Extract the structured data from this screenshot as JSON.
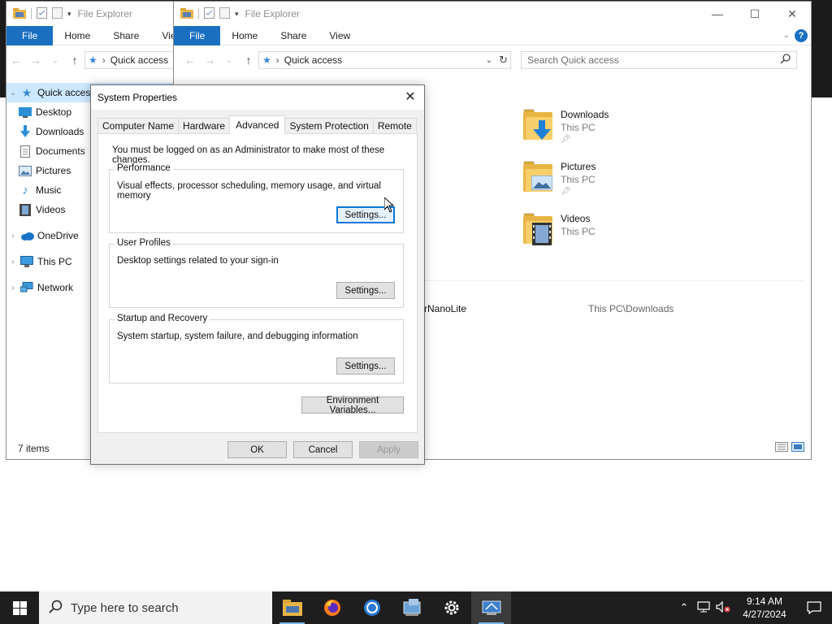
{
  "back_window": {
    "title": "File Explorer",
    "ribbon_tabs": [
      "File",
      "Home",
      "Share",
      "View"
    ],
    "address": "Quick access",
    "nav_items": [
      {
        "label": "Quick access"
      },
      {
        "label": "Desktop"
      },
      {
        "label": "Downloads"
      },
      {
        "label": "Documents"
      },
      {
        "label": "Pictures"
      },
      {
        "label": "Music"
      },
      {
        "label": "Videos"
      },
      {
        "label": "OneDrive"
      },
      {
        "label": "This PC"
      },
      {
        "label": "Network"
      }
    ],
    "status": "7 items"
  },
  "front_window": {
    "title": "File Explorer",
    "ribbon_tabs": [
      "File",
      "Home",
      "Share",
      "View"
    ],
    "address": "Quick access",
    "search_placeholder": "Search Quick access",
    "folders": [
      {
        "name": "Downloads",
        "location": "This PC"
      },
      {
        "name": "Pictures",
        "location": "This PC"
      },
      {
        "name": "Videos",
        "location": "This PC"
      }
    ],
    "recent_file": {
      "name": "rNanoLite",
      "path": "This PC\\Downloads"
    }
  },
  "dialog": {
    "title": "System Properties",
    "tabs": [
      "Computer Name",
      "Hardware",
      "Advanced",
      "System Protection",
      "Remote"
    ],
    "active_tab": "Advanced",
    "note": "You must be logged on as an Administrator to make most of these changes.",
    "groups": [
      {
        "label": "Performance",
        "description": "Visual effects, processor scheduling, memory usage, and virtual memory",
        "button": "Settings..."
      },
      {
        "label": "User Profiles",
        "description": "Desktop settings related to your sign-in",
        "button": "Settings..."
      },
      {
        "label": "Startup and Recovery",
        "description": "System startup, system failure, and debugging information",
        "button": "Settings..."
      }
    ],
    "env_button": "Environment Variables...",
    "ok": "OK",
    "cancel": "Cancel",
    "apply": "Apply"
  },
  "taskbar": {
    "search_placeholder": "Type here to search",
    "time": "9:14 AM",
    "date": "4/27/2024"
  },
  "colors": {
    "accent": "#0078d7",
    "file_tab": "#1a6fc1",
    "taskbar": "#1e1e1e"
  }
}
